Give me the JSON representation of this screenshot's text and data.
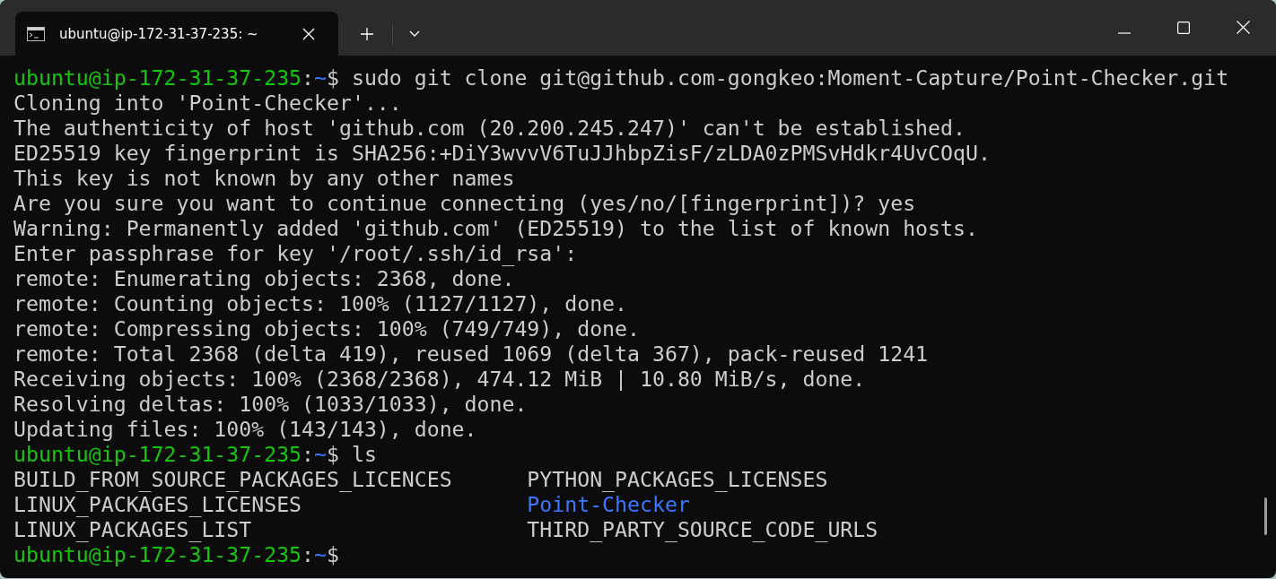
{
  "window": {
    "tab": {
      "title": "ubuntu@ip-172-31-37-235: ~",
      "selected": true
    }
  },
  "terminal": {
    "lines": [
      {
        "kind": "prompt",
        "user": "ubuntu@ip-172-31-37-235",
        "sep": ":",
        "path": "~",
        "symbol": "$",
        "command": "sudo git clone git@github.com-gongkeo:Moment-Capture/Point-Checker.git"
      },
      {
        "kind": "output",
        "text": "Cloning into 'Point-Checker'..."
      },
      {
        "kind": "output",
        "text": "The authenticity of host 'github.com (20.200.245.247)' can't be established."
      },
      {
        "kind": "output",
        "text": "ED25519 key fingerprint is SHA256:+DiY3wvvV6TuJJhbpZisF/zLDA0zPMSvHdkr4UvCOqU."
      },
      {
        "kind": "output",
        "text": "This key is not known by any other names"
      },
      {
        "kind": "output",
        "text": "Are you sure you want to continue connecting (yes/no/[fingerprint])? yes"
      },
      {
        "kind": "output",
        "text": "Warning: Permanently added 'github.com' (ED25519) to the list of known hosts."
      },
      {
        "kind": "output",
        "text": "Enter passphrase for key '/root/.ssh/id_rsa':"
      },
      {
        "kind": "output",
        "text": "remote: Enumerating objects: 2368, done."
      },
      {
        "kind": "output",
        "text": "remote: Counting objects: 100% (1127/1127), done."
      },
      {
        "kind": "output",
        "text": "remote: Compressing objects: 100% (749/749), done."
      },
      {
        "kind": "output",
        "text": "remote: Total 2368 (delta 419), reused 1069 (delta 367), pack-reused 1241"
      },
      {
        "kind": "output",
        "text": "Receiving objects: 100% (2368/2368), 474.12 MiB | 10.80 MiB/s, done."
      },
      {
        "kind": "output",
        "text": "Resolving deltas: 100% (1033/1033), done."
      },
      {
        "kind": "output",
        "text": "Updating files: 100% (143/143), done."
      },
      {
        "kind": "prompt",
        "user": "ubuntu@ip-172-31-37-235",
        "sep": ":",
        "path": "~",
        "symbol": "$",
        "command": "ls"
      },
      {
        "kind": "listing",
        "items": [
          {
            "kind": "file",
            "name": "BUILD_FROM_SOURCE_PACKAGES_LICENCES"
          },
          {
            "kind": "file",
            "name": "PYTHON_PACKAGES_LICENSES"
          }
        ]
      },
      {
        "kind": "listing",
        "items": [
          {
            "kind": "file",
            "name": "LINUX_PACKAGES_LICENSES"
          },
          {
            "kind": "directory",
            "name": "Point-Checker"
          }
        ]
      },
      {
        "kind": "listing",
        "items": [
          {
            "kind": "file",
            "name": "LINUX_PACKAGES_LIST"
          },
          {
            "kind": "file",
            "name": "THIRD_PARTY_SOURCE_CODE_URLS"
          }
        ]
      },
      {
        "kind": "prompt",
        "user": "ubuntu@ip-172-31-37-235",
        "sep": ":",
        "path": "~",
        "symbol": "$"
      }
    ]
  }
}
